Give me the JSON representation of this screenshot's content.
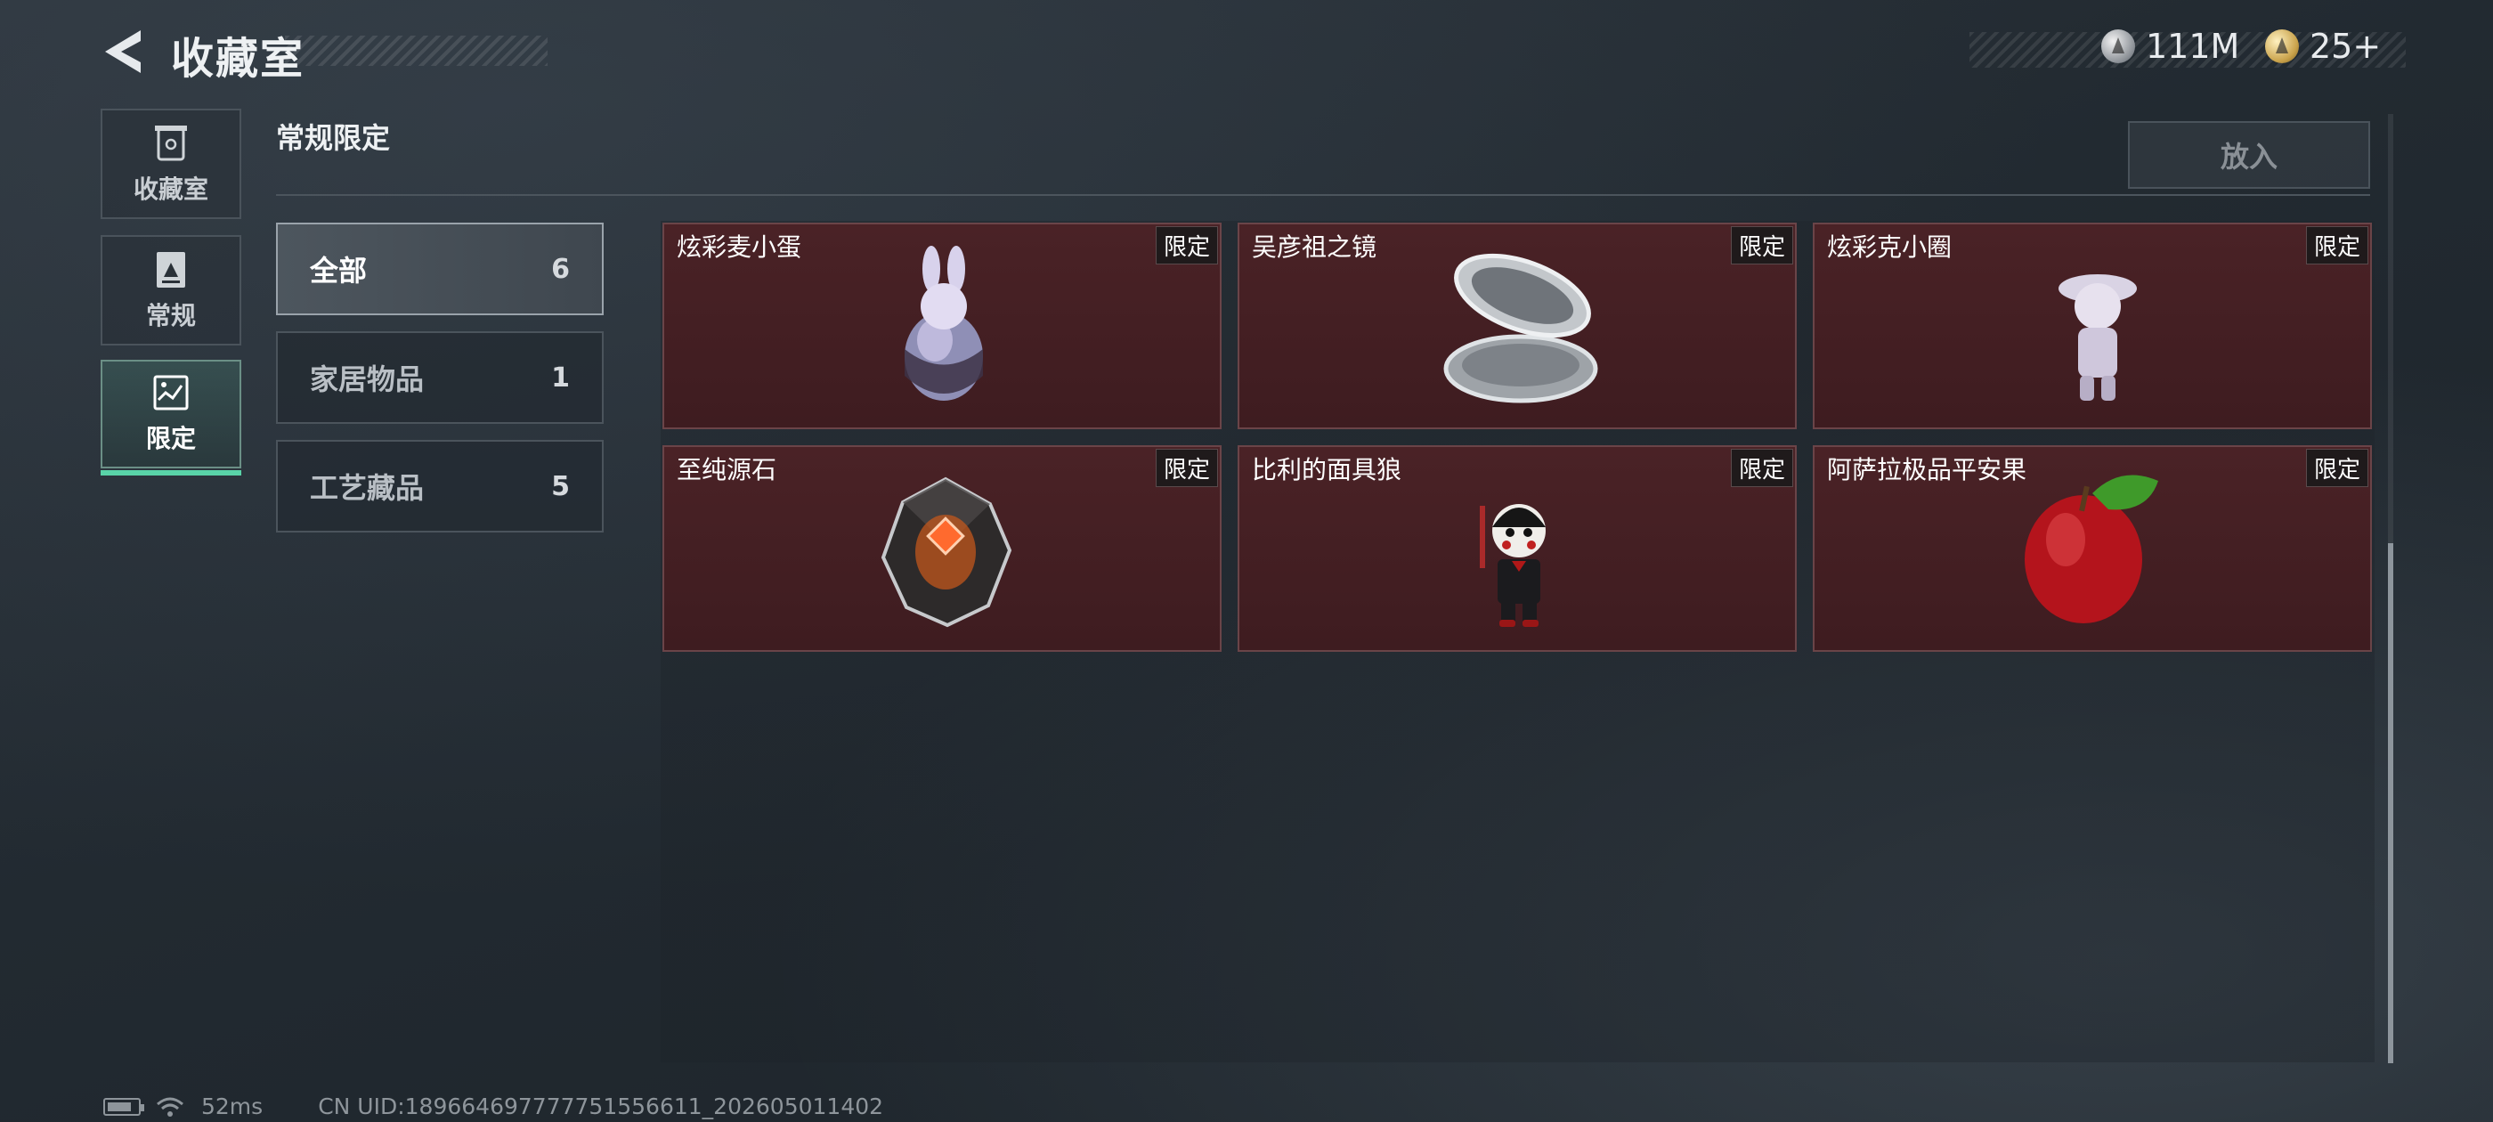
{
  "header": {
    "title": "收藏室",
    "currencies": [
      {
        "icon": "silver-coin-icon",
        "value": "111M"
      },
      {
        "icon": "gold-coin-icon",
        "value": "25+"
      }
    ]
  },
  "nav": {
    "items": [
      {
        "label": "收藏室",
        "icon": "trash-bin-icon"
      },
      {
        "label": "常规",
        "icon": "document-icon"
      },
      {
        "label": "限定",
        "icon": "image-icon"
      }
    ],
    "active": "限定"
  },
  "section": {
    "title": "常规限定",
    "put_button": "放入"
  },
  "categories": [
    {
      "name": "全部",
      "count": "6"
    },
    {
      "name": "家居物品",
      "count": "1"
    },
    {
      "name": "工艺藏品",
      "count": "5"
    }
  ],
  "items": [
    {
      "name": "炫彩麦小蛋",
      "tag": "限定",
      "icon": "bunny-egg-figure-icon"
    },
    {
      "name": "吴彦祖之镜",
      "tag": "限定",
      "icon": "compact-mirror-icon"
    },
    {
      "name": "炫彩克小圈",
      "tag": "限定",
      "icon": "girl-figurine-icon"
    },
    {
      "name": "至纯源石",
      "tag": "限定",
      "icon": "glowing-crystal-icon"
    },
    {
      "name": "比利的面具狼",
      "tag": "限定",
      "icon": "puppet-doll-icon"
    },
    {
      "name": "阿萨拉极品平安果",
      "tag": "限定",
      "icon": "red-apple-icon"
    }
  ],
  "footer": {
    "ping": "52ms",
    "uid": "CN UID:189664697777751556611_202605011402"
  },
  "colors": {
    "accent": "#59d3a8",
    "card_bg": "#44202a",
    "background": "#242c33"
  }
}
